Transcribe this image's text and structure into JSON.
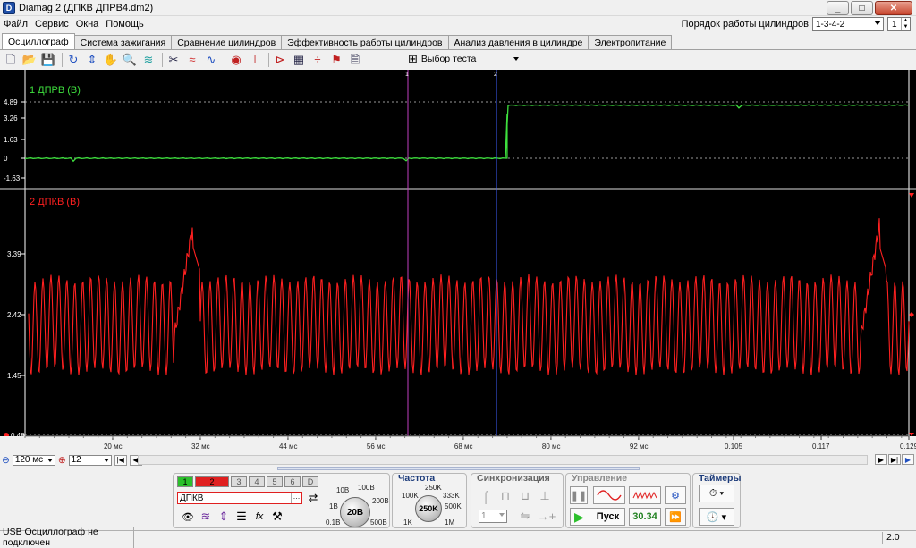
{
  "window": {
    "title": "Diamag 2 (ДПКВ ДПРВ4.dm2)",
    "app_icon": "D"
  },
  "menu": [
    "Файл",
    "Сервис",
    "Окна",
    "Помощь"
  ],
  "cylinder_order": {
    "label": "Порядок работы цилиндров",
    "value": "1-3-4-2",
    "spin_value": "1"
  },
  "tabs": [
    "Осциллограф",
    "Система зажигания",
    "Сравнение цилиндров",
    "Эффективность работы цилиндров",
    "Анализ давления в цилиндре",
    "Электропитание"
  ],
  "test_select": {
    "label": "Выбор теста"
  },
  "oscillograph": {
    "ch1": {
      "label": "1 ДПРВ (В)",
      "color": "#3ee03e",
      "ticks": [
        "4.89",
        "3.26",
        "1.63",
        "0",
        "-1.63"
      ]
    },
    "ch2": {
      "label": "2 ДПКВ (В)",
      "color": "#ff2020",
      "ticks": [
        "3.39",
        "2.42",
        "1.45",
        "0.48"
      ]
    },
    "cursor1": {
      "label": "1",
      "color": "#c040c0"
    },
    "cursor2": {
      "label": "2",
      "color": "#4060ff"
    },
    "xticks": [
      "20 мс",
      "32 мс",
      "44 мс",
      "56 мс",
      "68 мс",
      "80 мс",
      "92 мс",
      "0.105",
      "0.117",
      "0.129"
    ]
  },
  "chart_data": {
    "type": "line",
    "xlabel": "",
    "series": [
      {
        "name": "1 ДПРВ (В)",
        "description_values": {
          "low": 0,
          "high": 4.6,
          "switch_x_ms": 74
        }
      },
      {
        "name": "2 ДПКВ (В)",
        "description_values": {
          "center": 2.25,
          "amplitude": 0.75,
          "gap_x_ms": [
            31,
            125
          ]
        }
      }
    ]
  },
  "bottombar": {
    "timebase": "120 мс",
    "zoom": "12"
  },
  "channels": {
    "buttons": [
      "1",
      "2",
      "3",
      "4",
      "5",
      "6",
      "D"
    ],
    "name": "ДПКВ"
  },
  "volts_knob": {
    "value": "20В",
    "labels": [
      "10В",
      "100В",
      "1В",
      "200В",
      "0.1В",
      "500В"
    ]
  },
  "freq": {
    "title": "Частота",
    "value": "250K",
    "labels": [
      "250K",
      "100K",
      "333K",
      "500K",
      "1K",
      "1M"
    ]
  },
  "sync": {
    "title": "Синхронизация",
    "value": "1"
  },
  "control": {
    "title": "Управление",
    "start_label": "Пуск",
    "speed": "30.34"
  },
  "timers": {
    "title": "Таймеры"
  },
  "status": {
    "left": "USB Осциллограф не подключен",
    "right": "2.0"
  }
}
